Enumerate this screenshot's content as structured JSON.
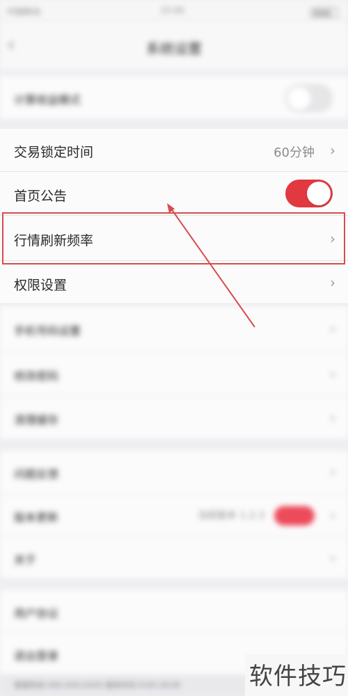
{
  "status_bar": {
    "carrier": "中国移动",
    "time": "15:00"
  },
  "nav": {
    "title": "系统设置",
    "back_icon": "chevron-left-icon"
  },
  "top_setting": {
    "label": "计算收益模式"
  },
  "settings": {
    "trade_lock": {
      "label": "交易锁定时间",
      "value": "60分钟"
    },
    "home_notice": {
      "label": "首页公告",
      "on": true
    },
    "refresh_rate": {
      "label": "行情刷新频率"
    },
    "permission": {
      "label": "权限设置"
    }
  },
  "blurred_rows": [
    {
      "label": "手机号码设置"
    },
    {
      "label": "修改密码"
    },
    {
      "label": "清理缓存"
    },
    {
      "label": "问题反馈"
    },
    {
      "label": "版本更新",
      "value": "当前版本 1.2.3"
    },
    {
      "label": "关于"
    },
    {
      "label": "用户协议"
    },
    {
      "label": "退出登录"
    }
  ],
  "footer": {
    "text": "客服热线 400-XXX-XXXX 服务时间 9:00-18:00"
  },
  "watermark": {
    "text": "软件技巧"
  },
  "colors": {
    "accent": "#e2383f",
    "highlight_border": "#d94b4b",
    "arrow": "#d94b4b"
  }
}
